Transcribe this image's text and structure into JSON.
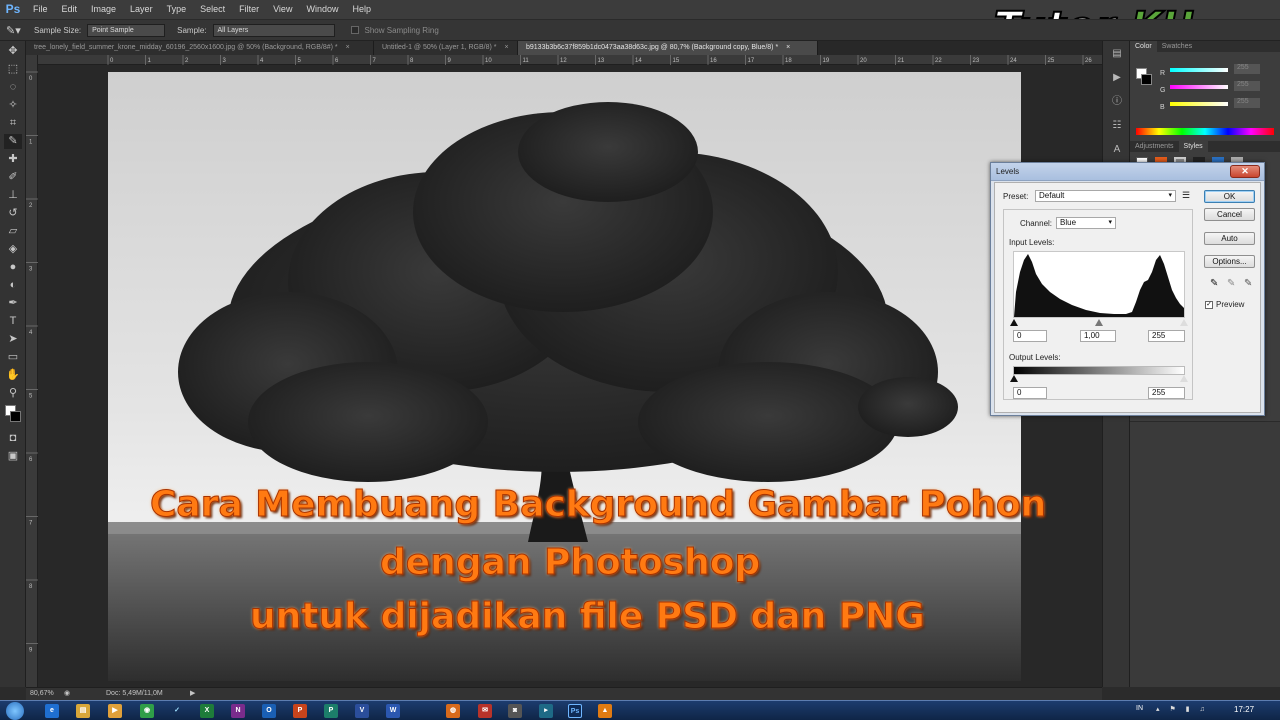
{
  "menubar": {
    "app_logo": "Ps",
    "items": [
      "File",
      "Edit",
      "Image",
      "Layer",
      "Type",
      "Select",
      "Filter",
      "View",
      "Window",
      "Help"
    ]
  },
  "options_bar": {
    "sample_size_label": "Sample Size:",
    "sample_size_value": "Point Sample",
    "sample_label": "Sample:",
    "sample_value": "All Layers",
    "show_sampling_ring": "Show Sampling Ring"
  },
  "tabs": [
    {
      "label": "tree_lonely_field_summer_krone_midday_60196_2560x1600.jpg @ 50% (Background, RGB/8#) *",
      "active": false
    },
    {
      "label": "Untitled-1 @ 50% (Layer 1, RGB/8) *",
      "active": false
    },
    {
      "label": "b9133b3b6c37f859b1dc0473aa38d63c.jpg @ 80,7% (Background copy, Blue/8) *",
      "active": true
    }
  ],
  "ruler": {
    "top_ticks": [
      "0",
      "1",
      "2",
      "3",
      "4",
      "5",
      "6",
      "7",
      "8",
      "9",
      "10",
      "11",
      "12",
      "13",
      "14",
      "15",
      "16",
      "17",
      "18",
      "19",
      "20",
      "21",
      "22",
      "23",
      "24",
      "25",
      "26"
    ],
    "left_ticks": [
      "0",
      "1",
      "2",
      "3",
      "4",
      "5",
      "6",
      "7",
      "8",
      "9"
    ]
  },
  "right_panels": {
    "color_tabs": [
      "Color",
      "Swatches"
    ],
    "channels": [
      "R",
      "G",
      "B"
    ],
    "channel_values": [
      "255",
      "255",
      "255"
    ],
    "adjust_tabs": [
      "Adjustments",
      "Styles"
    ]
  },
  "levels": {
    "title": "Levels",
    "close": "✕",
    "preset_label": "Preset:",
    "preset_value": "Default",
    "channel_label": "Channel:",
    "channel_value": "Blue",
    "input_levels_label": "Input Levels:",
    "input_black": "0",
    "input_mid": "1,00",
    "input_white": "255",
    "output_levels_label": "Output Levels:",
    "output_black": "0",
    "output_white": "255",
    "buttons": {
      "ok": "OK",
      "cancel": "Cancel",
      "auto": "Auto",
      "options": "Options..."
    },
    "preview_label": "Preview",
    "preview_checked": true
  },
  "status": {
    "zoom": "80,67%",
    "doc": "Doc: 5,49M/11,0M"
  },
  "taskbar": {
    "lang": "IN",
    "time": "17:27"
  },
  "watermark": {
    "part1": "Tutor",
    "part2": "KU"
  },
  "overlay": {
    "line1": "Cara Membuang Background Gambar Pohon",
    "line2": "dengan Photoshop",
    "line3": "untuk dijadikan file PSD dan PNG"
  },
  "colors": {
    "overlay_text": "#ff7a12",
    "watermark_green": "#5aa53a",
    "ps_blue": "#6fb6ff"
  }
}
